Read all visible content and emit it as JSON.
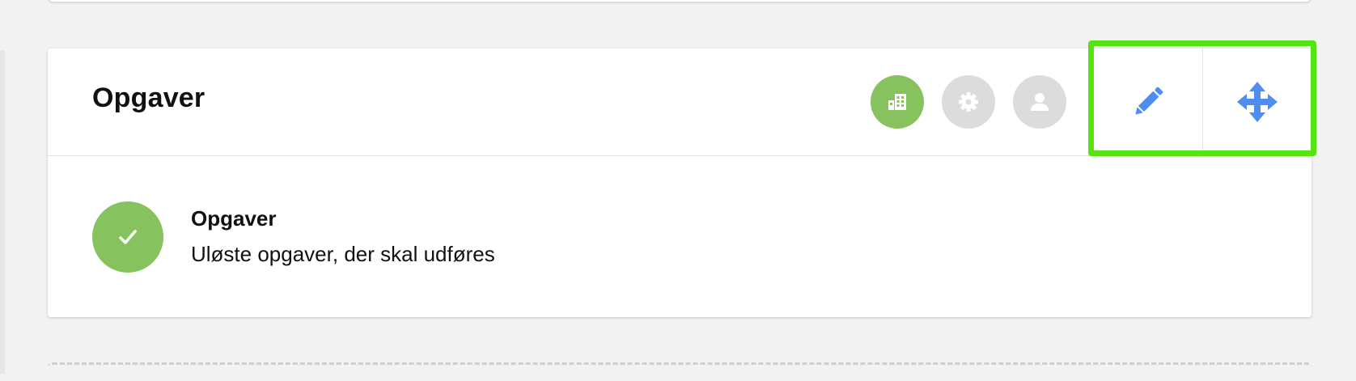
{
  "widget": {
    "title": "Opgaver",
    "header_buttons": [
      {
        "icon": "company-icon",
        "color": "#86c35f"
      },
      {
        "icon": "gear-icon",
        "color": "#dcdcdc"
      },
      {
        "icon": "user-icon",
        "color": "#dcdcdc"
      }
    ],
    "actions": [
      {
        "icon": "pencil-icon",
        "color": "#4f8ef0"
      },
      {
        "icon": "move-icon",
        "color": "#4f8ef0"
      }
    ],
    "highlight_color": "#55e312"
  },
  "task": {
    "title": "Opgaver",
    "description": "Uløste opgaver, der skal udføres",
    "status_icon": "check-icon",
    "status_color": "#86c35f"
  }
}
